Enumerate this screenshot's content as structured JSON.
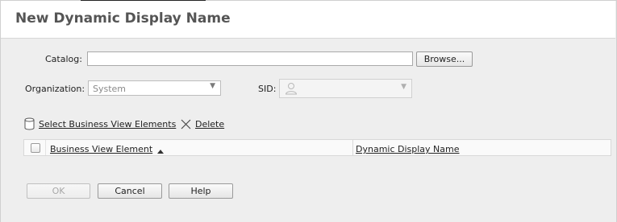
{
  "dialog": {
    "title": "New Dynamic Display Name"
  },
  "catalog": {
    "label": "Catalog:",
    "value": "",
    "browse_label": "Browse..."
  },
  "organization": {
    "label": "Organization:",
    "selected": "System"
  },
  "sid": {
    "label": "SID:",
    "selected": ""
  },
  "toolbar": {
    "select_label": "Select Business View Elements",
    "delete_label": "Delete"
  },
  "table": {
    "columns": [
      {
        "label": "Business View Element",
        "sort": "ascending"
      },
      {
        "label": "Dynamic Display Name"
      }
    ]
  },
  "buttons": {
    "ok": "OK",
    "cancel": "Cancel",
    "help": "Help"
  },
  "icons": {
    "database": "database-icon",
    "delete": "x-icon",
    "user": "user-icon",
    "dropdown": "chevron-down-icon",
    "sort": "sort-ascending-icon"
  }
}
